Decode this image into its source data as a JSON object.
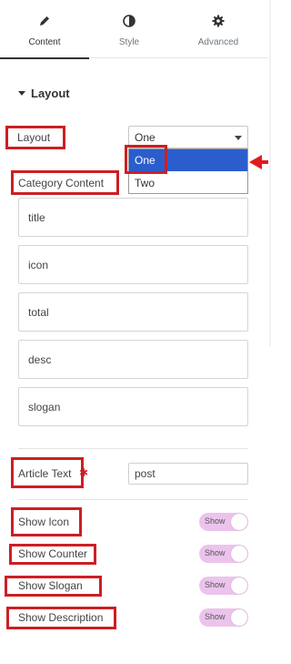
{
  "tabs": [
    {
      "label": "Content",
      "icon": "pencil-icon",
      "active": true
    },
    {
      "label": "Style",
      "icon": "contrast-icon",
      "active": false
    },
    {
      "label": "Advanced",
      "icon": "gear-icon",
      "active": false
    }
  ],
  "section": {
    "title": "Layout"
  },
  "layout_field": {
    "label": "Layout",
    "value": "One",
    "options": [
      "One",
      "Two"
    ],
    "selected_option": "One"
  },
  "category_content": {
    "label": "Category Content",
    "items": [
      "title",
      "icon",
      "total",
      "desc",
      "slogan"
    ]
  },
  "article_text": {
    "label": "Article Text",
    "marker": "✱",
    "value": "post"
  },
  "toggles": [
    {
      "label": "Show Icon",
      "state": "Show"
    },
    {
      "label": "Show Counter",
      "state": "Show"
    },
    {
      "label": "Show Slogan",
      "state": "Show"
    },
    {
      "label": "Show Description",
      "state": "Show"
    }
  ],
  "colors": {
    "highlight_box": "#cc1f24",
    "selected_option": "#2b5dcd",
    "toggle_on": "#ecc3ec"
  }
}
